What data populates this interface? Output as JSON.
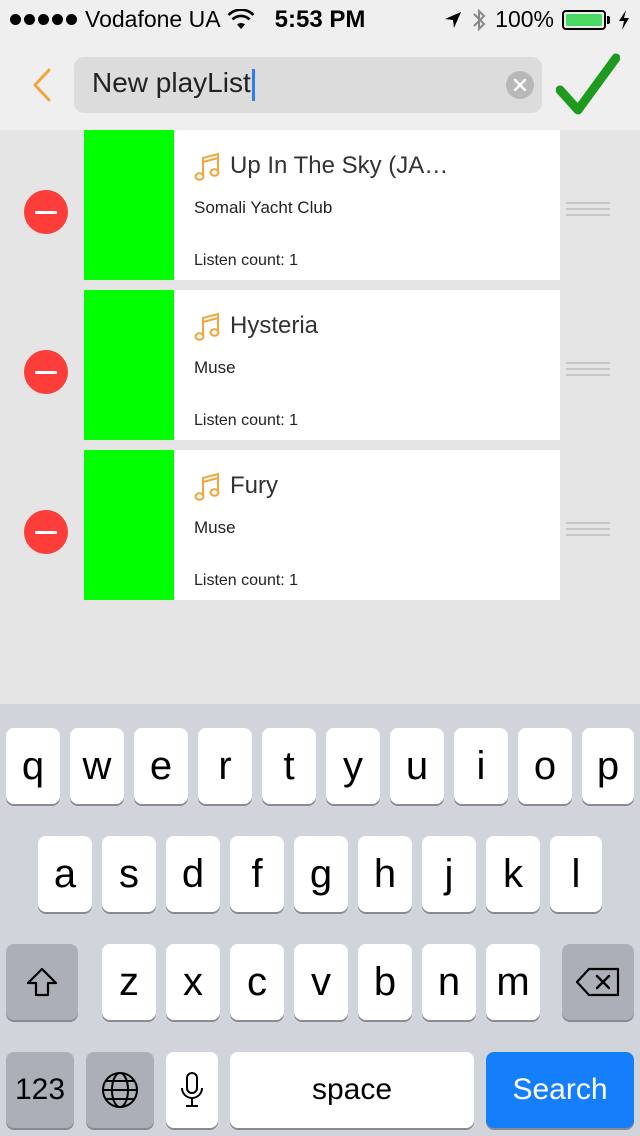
{
  "status_bar": {
    "carrier": "Vodafone UA",
    "time": "5:53 PM",
    "battery": "100%",
    "battery_level": 1.0,
    "signal_bars": 5,
    "icons": [
      "wifi-icon",
      "location-arrow-icon",
      "bluetooth-icon",
      "battery-icon",
      "charging-icon"
    ]
  },
  "header": {
    "playlist_name": "New playList",
    "back_icon": "chevron-left-icon",
    "clear_icon": "clear-icon",
    "confirm_icon": "checkmark-icon"
  },
  "colors": {
    "accent_orange": "#f0a63a",
    "delete_red": "#fc3d39",
    "confirm_green": "#1e9a1e",
    "artwork_green": "#00ff00",
    "search_key_blue": "#147efb"
  },
  "tracks": [
    {
      "title": "Up In The Sky (JA…",
      "artist": "Somali Yacht Club",
      "listen_count": "Listen count: 1"
    },
    {
      "title": "Hysteria",
      "artist": "Muse",
      "listen_count": "Listen count: 1"
    },
    {
      "title": "Fury",
      "artist": "Muse",
      "listen_count": "Listen count: 1"
    }
  ],
  "keyboard": {
    "row1": [
      "q",
      "w",
      "e",
      "r",
      "t",
      "y",
      "u",
      "i",
      "o",
      "p"
    ],
    "row2": [
      "a",
      "s",
      "d",
      "f",
      "g",
      "h",
      "j",
      "k",
      "l"
    ],
    "row3": [
      "z",
      "x",
      "c",
      "v",
      "b",
      "n",
      "m"
    ],
    "numbers_key": "123",
    "space_key": "space",
    "search_key": "Search",
    "special_icons": [
      "shift-icon",
      "backspace-icon",
      "globe-icon",
      "microphone-icon"
    ]
  }
}
